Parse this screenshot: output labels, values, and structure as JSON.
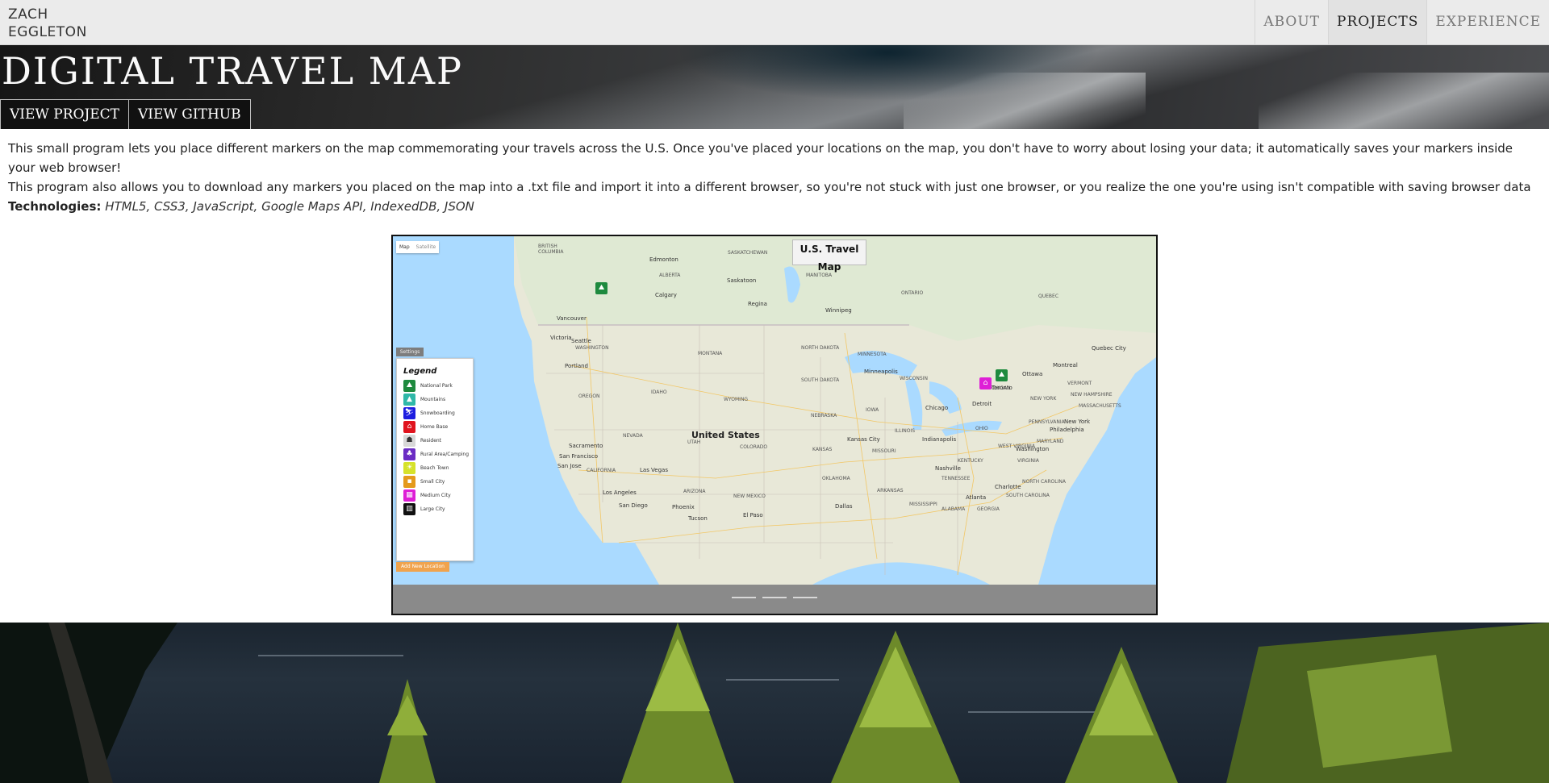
{
  "nav": {
    "brand_line1": "ZACH",
    "brand_line2": "EGGLETON",
    "links": [
      {
        "label": "ABOUT",
        "active": false
      },
      {
        "label": "PROJECTS",
        "active": true
      },
      {
        "label": "EXPERIENCE",
        "active": false
      }
    ]
  },
  "hero": {
    "title": "DIGITAL TRAVEL MAP",
    "view_project": "VIEW PROJECT",
    "view_github": "VIEW GITHUB"
  },
  "description": {
    "line1": "This small program lets you place different markers on the map commemorating your travels across the U.S. Once you've placed your locations on the map, you don't have to worry about losing your data; it automatically saves your markers inside your web browser!",
    "line2": "This program also allows you to download any markers you placed on the map into a .txt file and import it into a different browser, so you're not stuck with just one browser, or you realize the one you're using isn't compatible with saving browser data",
    "tech_label": "Technologies:",
    "tech_value": "HTML5, CSS3, JavaScript, Google Maps API, IndexedDB, JSON"
  },
  "screenshot": {
    "map_type_map": "Map",
    "map_type_satellite": "Satellite",
    "map_title": "U.S. Travel Map",
    "settings": "Settings",
    "legend_title": "Legend",
    "legend": [
      {
        "label": "National Park",
        "color": "#1e8a3e",
        "icon": "national-park-icon"
      },
      {
        "label": "Mountains",
        "color": "#2fb8a8",
        "icon": "mountain-icon"
      },
      {
        "label": "Snowboarding",
        "color": "#1d1de0",
        "icon": "snowboarder-icon"
      },
      {
        "label": "Home Base",
        "color": "#e0141e",
        "icon": "home-icon"
      },
      {
        "label": "Resident",
        "color": "#d8d8d8",
        "icon": "resident-icon"
      },
      {
        "label": "Rural Area/Camping",
        "color": "#6b2cc4",
        "icon": "camping-icon"
      },
      {
        "label": "Beach Town",
        "color": "#d6e22a",
        "icon": "beach-icon"
      },
      {
        "label": "Small City",
        "color": "#e49a1c",
        "icon": "small-city-icon"
      },
      {
        "label": "Medium City",
        "color": "#de1fd6",
        "icon": "medium-city-icon"
      },
      {
        "label": "Large City",
        "color": "#111111",
        "icon": "large-city-icon"
      }
    ],
    "add_location": "Add New Location",
    "map_labels": [
      "BRITISH COLUMBIA",
      "Edmonton",
      "SASKATCHEWAN",
      "ALBERTA",
      "Saskatoon",
      "Calgary",
      "Regina",
      "Winnipeg",
      "MANITOBA",
      "ONTARIO",
      "QUEBEC",
      "Vancouver",
      "Victoria",
      "Seattle",
      "WASHINGTON",
      "Portland",
      "MONTANA",
      "NORTH DAKOTA",
      "MINNESOTA",
      "OREGON",
      "IDAHO",
      "SOUTH DAKOTA",
      "Minneapolis",
      "WISCONSIN",
      "WYOMING",
      "MICHIGAN",
      "Ottawa",
      "Montreal",
      "Quebec City",
      "Toronto",
      "NEBRASKA",
      "IOWA",
      "Chicago",
      "Detroit",
      "NEW YORK",
      "VERMONT",
      "NEW HAMPSHIRE",
      "MASSACHUSETTS",
      "NEVADA",
      "UTAH",
      "United States",
      "Kansas City",
      "ILLINOIS",
      "Indianapolis",
      "OHIO",
      "PENNSYLVANIA",
      "New York",
      "Philadelphia",
      "Sacramento",
      "San Francisco",
      "COLORADO",
      "KANSAS",
      "MISSOURI",
      "KENTUCKY",
      "WEST VIRGINIA",
      "Washington",
      "VIRGINIA",
      "MARYLAND",
      "San Jose",
      "CALIFORNIA",
      "Las Vegas",
      "ARIZONA",
      "OKLAHOMA",
      "TENNESSEE",
      "Nashville",
      "NORTH CAROLINA",
      "Charlotte",
      "Los Angeles",
      "NEW MEXICO",
      "ARKANSAS",
      "SOUTH CAROLINA",
      "San Diego",
      "Phoenix",
      "Atlanta",
      "Tucson",
      "El Paso",
      "Dallas",
      "MISSISSIPPI",
      "ALABAMA",
      "GEORGIA"
    ]
  }
}
